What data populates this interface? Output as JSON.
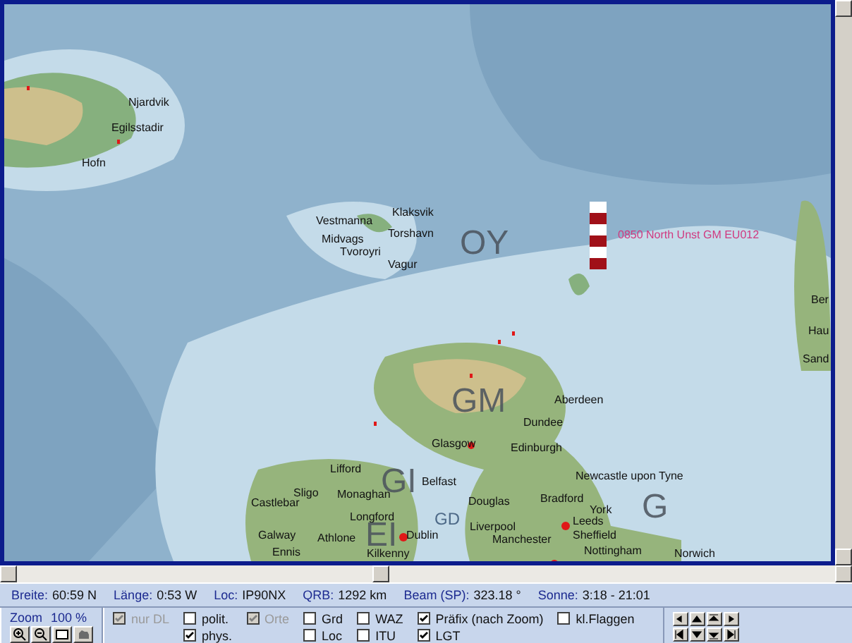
{
  "map": {
    "labels": [
      {
        "text": "Njardvik",
        "kind": "place"
      },
      {
        "text": "Egilsstadir",
        "kind": "place"
      },
      {
        "text": "Hofn",
        "kind": "place"
      },
      {
        "text": "Klaksvik",
        "kind": "place"
      },
      {
        "text": "Vestmanna",
        "kind": "place"
      },
      {
        "text": "Torshavn",
        "kind": "place"
      },
      {
        "text": "OY",
        "kind": "prefix"
      },
      {
        "text": "0850 North Unst GM EU012",
        "kind": "callout"
      },
      {
        "text": "Midvags",
        "kind": "place"
      },
      {
        "text": "Tvoroyri",
        "kind": "place"
      },
      {
        "text": "Vagur",
        "kind": "place"
      },
      {
        "text": "Ber",
        "kind": "place"
      },
      {
        "text": "Hau",
        "kind": "place"
      },
      {
        "text": "Sand",
        "kind": "place"
      },
      {
        "text": "GM",
        "kind": "prefix"
      },
      {
        "text": "Aberdeen",
        "kind": "place"
      },
      {
        "text": "Dundee",
        "kind": "place"
      },
      {
        "text": "Glasgow",
        "kind": "place"
      },
      {
        "text": "Edinburgh",
        "kind": "place"
      },
      {
        "text": "Lifford",
        "kind": "place"
      },
      {
        "text": "GI",
        "kind": "prefix"
      },
      {
        "text": "Belfast",
        "kind": "place"
      },
      {
        "text": "Newcastle upon Tyne",
        "kind": "place"
      },
      {
        "text": "Castlebar",
        "kind": "place"
      },
      {
        "text": "Sligo",
        "kind": "place"
      },
      {
        "text": "Monaghan",
        "kind": "place"
      },
      {
        "text": "Douglas",
        "kind": "place"
      },
      {
        "text": "Bradford",
        "kind": "place"
      },
      {
        "text": "York",
        "kind": "place"
      },
      {
        "text": "G",
        "kind": "prefix"
      },
      {
        "text": "Longford",
        "kind": "place"
      },
      {
        "text": "EI",
        "kind": "prefix"
      },
      {
        "text": "GD",
        "kind": "prefix-small"
      },
      {
        "text": "Liverpool",
        "kind": "place"
      },
      {
        "text": "Leeds",
        "kind": "place"
      },
      {
        "text": "Galway",
        "kind": "place"
      },
      {
        "text": "Athlone",
        "kind": "place"
      },
      {
        "text": "Dublin",
        "kind": "place"
      },
      {
        "text": "Manchester",
        "kind": "place"
      },
      {
        "text": "Sheffield",
        "kind": "place"
      },
      {
        "text": "Ennis",
        "kind": "place"
      },
      {
        "text": "Kilkenny",
        "kind": "place"
      },
      {
        "text": "Nottingham",
        "kind": "place"
      },
      {
        "text": "Norwich",
        "kind": "place"
      }
    ]
  },
  "status_bar": [
    {
      "label": "Breite:",
      "value": "60:59 N"
    },
    {
      "label": "Länge:",
      "value": "0:53 W"
    },
    {
      "label": "Loc:",
      "value": "IP90NX"
    },
    {
      "label": "QRB:",
      "value": "1292 km"
    },
    {
      "label": "Beam (SP):",
      "value": "323.18 °"
    },
    {
      "label": "Sonne:",
      "value": "3:18 - 21:01"
    }
  ],
  "zoom": {
    "label": "Zoom",
    "value": "100 %"
  },
  "checkbox_groups": [
    [
      {
        "label": "nur DL",
        "checked": true,
        "disabled": true
      }
    ],
    [
      {
        "label": "polit.",
        "checked": false,
        "disabled": false
      },
      {
        "label": "phys.",
        "checked": true,
        "disabled": false
      }
    ],
    [
      {
        "label": "Orte",
        "checked": true,
        "disabled": true
      }
    ],
    [
      {
        "label": "Grd",
        "checked": false,
        "disabled": false
      },
      {
        "label": "Loc",
        "checked": false,
        "disabled": false
      }
    ],
    [
      {
        "label": "WAZ",
        "checked": false,
        "disabled": false
      },
      {
        "label": "ITU",
        "checked": false,
        "disabled": false
      }
    ],
    [
      {
        "label": "Präfix (nach Zoom)",
        "checked": true,
        "disabled": false
      },
      {
        "label": "LGT",
        "checked": true,
        "disabled": false
      }
    ],
    [
      {
        "label": "kl.Flaggen",
        "checked": false,
        "disabled": false
      }
    ]
  ]
}
